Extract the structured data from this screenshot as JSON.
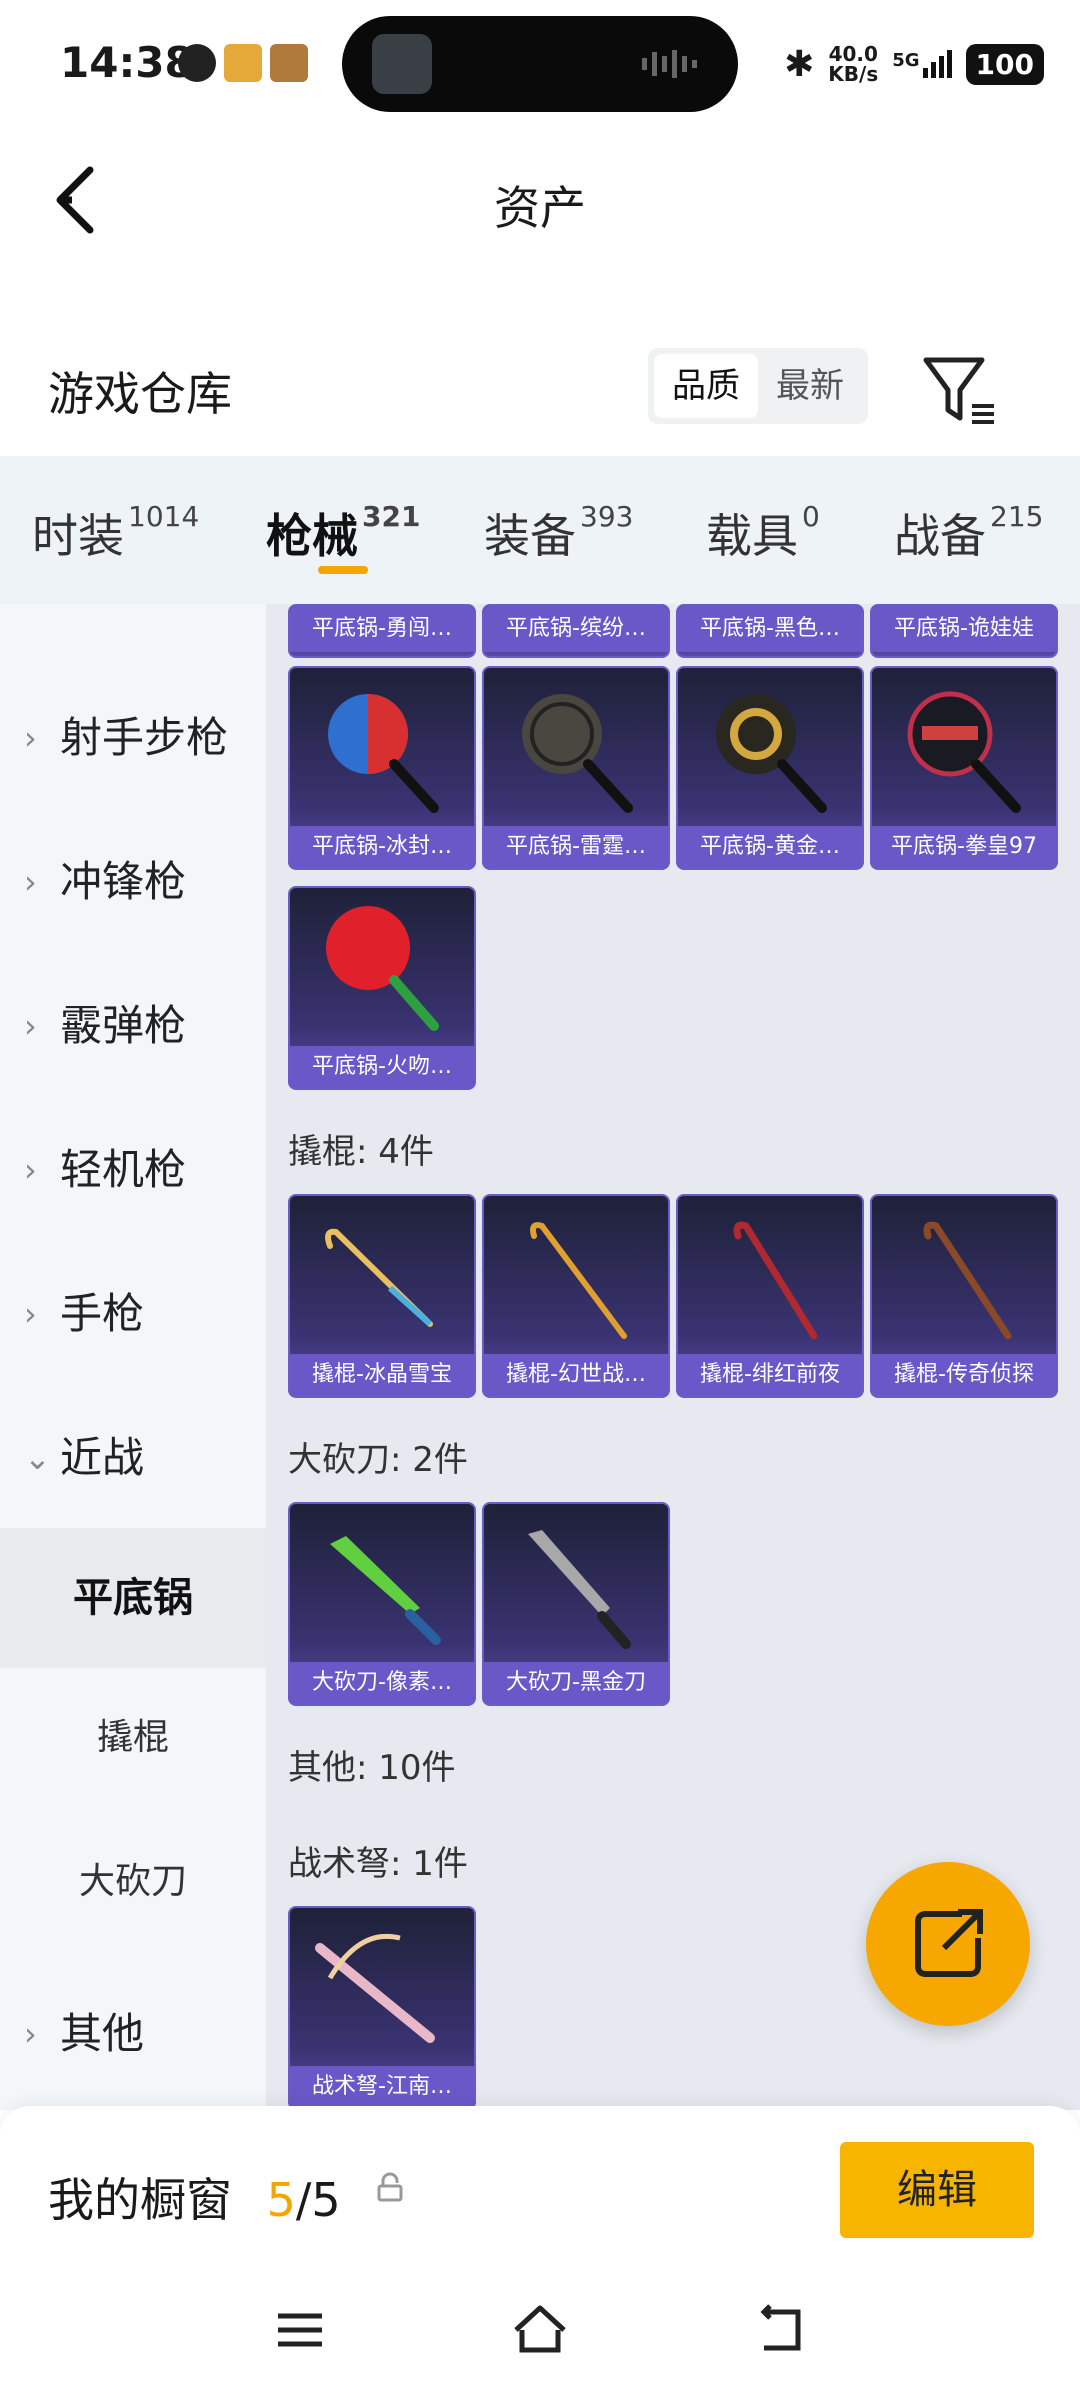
{
  "status_bar": {
    "time": "14:38",
    "net_speed_value": "40.0",
    "net_speed_unit": "KB/s",
    "network": "5G",
    "battery": "100"
  },
  "header": {
    "title": "资产"
  },
  "warehouse": {
    "title": "游戏仓库",
    "sort_options": [
      "品质",
      "最新"
    ],
    "selected_sort": "品质"
  },
  "tabs": [
    {
      "label": "时装",
      "count": "1014"
    },
    {
      "label": "枪械",
      "count": "321",
      "active": true
    },
    {
      "label": "装备",
      "count": "393"
    },
    {
      "label": "载具",
      "count": "0"
    },
    {
      "label": "战备",
      "count": "215"
    }
  ],
  "sidebar": {
    "items": [
      {
        "label": "射手步枪",
        "expanded": false
      },
      {
        "label": "冲锋枪",
        "expanded": false
      },
      {
        "label": "霰弹枪",
        "expanded": false
      },
      {
        "label": "轻机枪",
        "expanded": false
      },
      {
        "label": "手枪",
        "expanded": false
      },
      {
        "label": "近战",
        "expanded": true
      },
      {
        "label": "其他",
        "expanded": false
      }
    ],
    "subitems": [
      {
        "label": "平底锅",
        "active": true
      },
      {
        "label": "撬棍"
      },
      {
        "label": "大砍刀"
      }
    ]
  },
  "content": {
    "pan_top_row": [
      "平底锅-勇闯…",
      "平底锅-缤纷…",
      "平底锅-黑色…",
      "平底锅-诡娃娃"
    ],
    "pan_row2": [
      "平底锅-冰封…",
      "平底锅-雷霆…",
      "平底锅-黄金…",
      "平底锅-拳皇97"
    ],
    "pan_row3": [
      "平底锅-火吻…"
    ],
    "crowbar_label": "撬棍: 4件",
    "crowbar_items": [
      "撬棍-冰晶雪宝",
      "撬棍-幻世战…",
      "撬棍-绯红前夜",
      "撬棍-传奇侦探"
    ],
    "machete_label": "大砍刀: 2件",
    "machete_items": [
      "大砍刀-像素…",
      "大砍刀-黑金刀"
    ],
    "other_label": "其他: 10件",
    "crossbow_label": "战术弩: 1件",
    "crossbow_items": [
      "战术弩-江南…"
    ]
  },
  "showcase": {
    "title": "我的橱窗",
    "used": "5",
    "separator": "/",
    "total": "5",
    "edit_label": "编辑"
  },
  "colors": {
    "accent": "#f7b500",
    "card_caption": "#6b58c8"
  }
}
